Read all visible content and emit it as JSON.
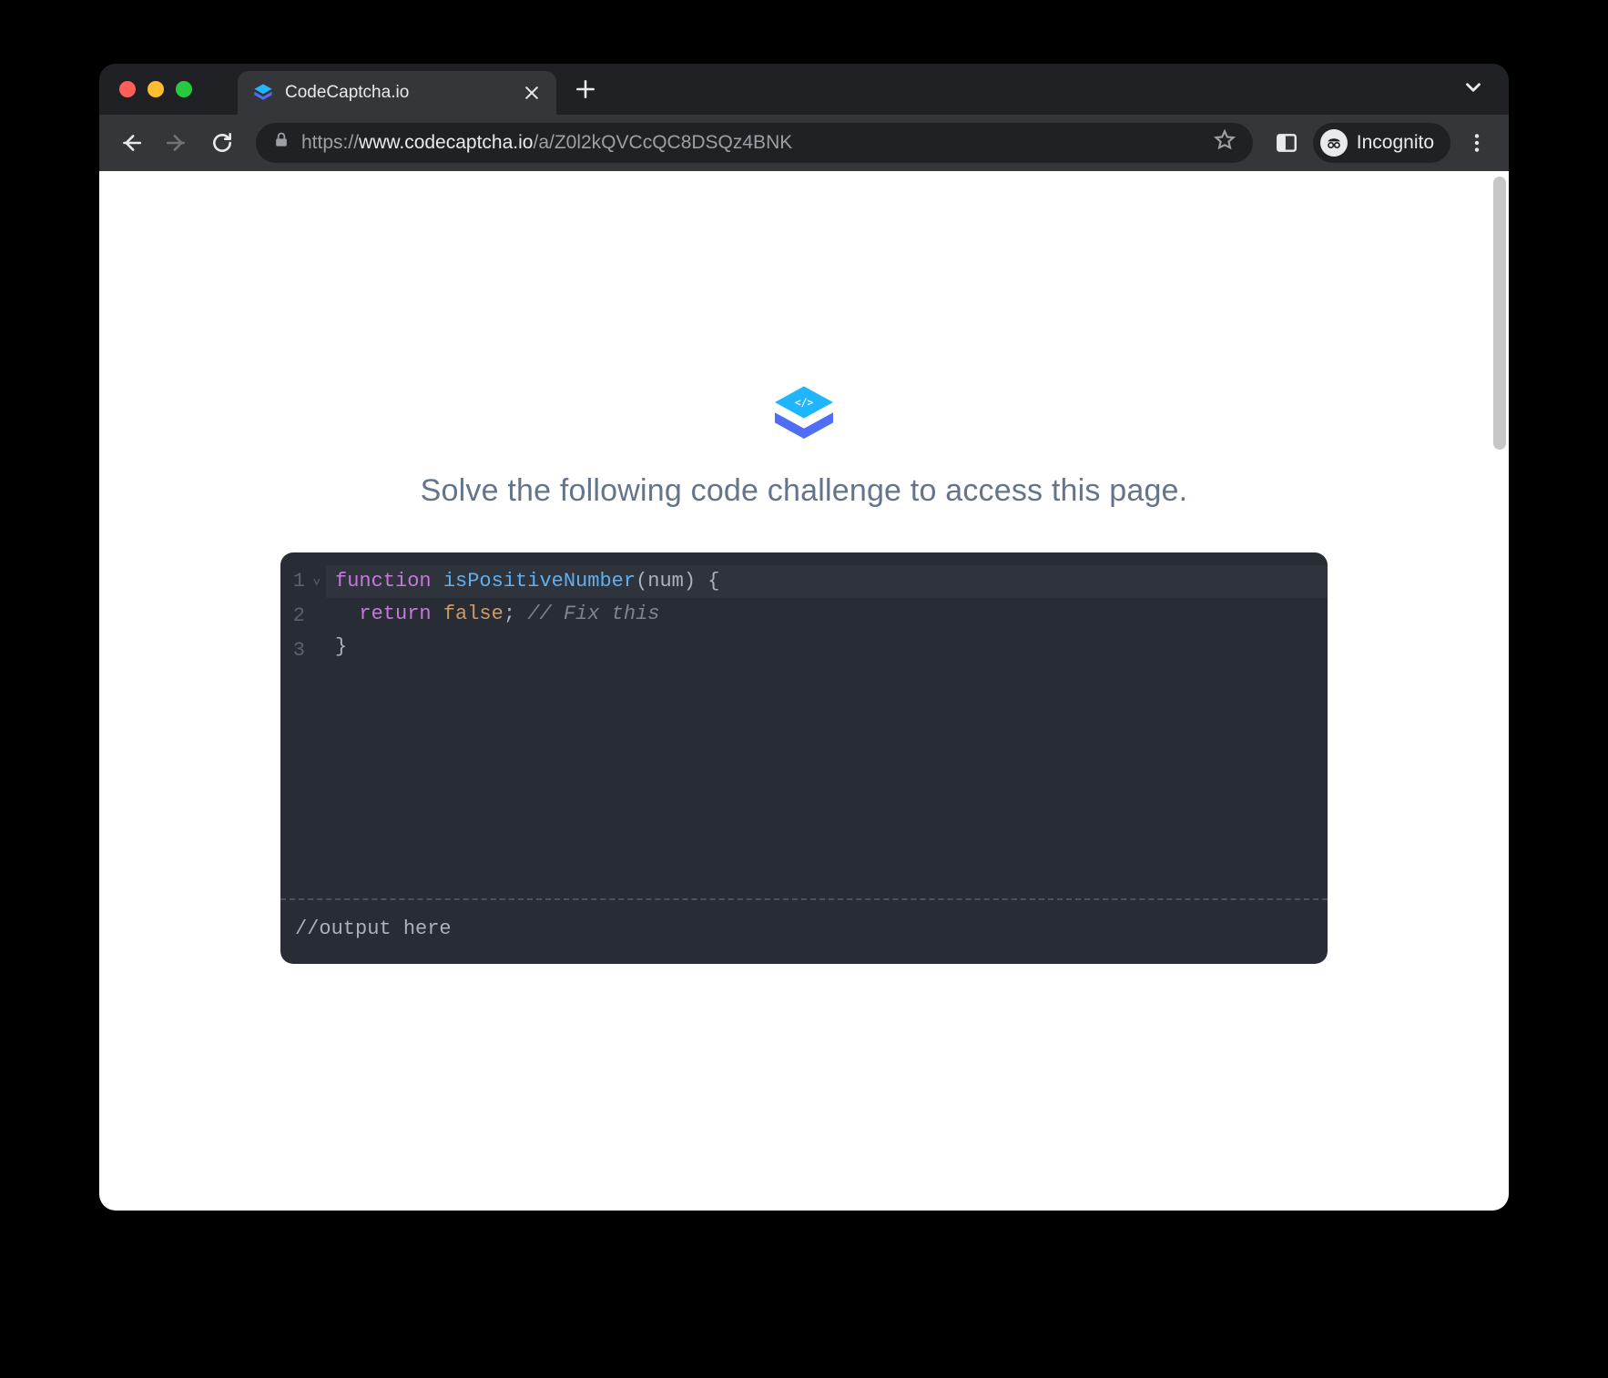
{
  "browser": {
    "tab": {
      "title": "CodeCaptcha.io"
    },
    "url": {
      "scheme": "https://",
      "host": "www.codecaptcha.io",
      "path": "/a/Z0l2kQVCcQC8DSQz4BNK"
    },
    "incognito_label": "Incognito"
  },
  "page": {
    "prompt": "Solve the following code challenge to access this page.",
    "output_placeholder": "//output here"
  },
  "editor": {
    "line_numbers": [
      "1",
      "2",
      "3"
    ],
    "fold_marker": "˅",
    "code": {
      "line1": {
        "kw_function": "function",
        "fn_name": "isPositiveNumber",
        "open_paren": "(",
        "param": "num",
        "close_paren": ")",
        "space_brace": " {"
      },
      "line2": {
        "indent": "  ",
        "kw_return": "return",
        "const_false": "false",
        "semicolon": ";",
        "comment": " // Fix this"
      },
      "line3": {
        "text": "}"
      }
    }
  },
  "colors": {
    "editor_bg": "#282c34",
    "page_bg": "#ffffff",
    "chrome_bg": "#35363a",
    "tabbar_bg": "#202124",
    "prompt_text": "#64748b",
    "logo_top": "#22b8ff",
    "logo_bottom": "#4f6df5"
  }
}
